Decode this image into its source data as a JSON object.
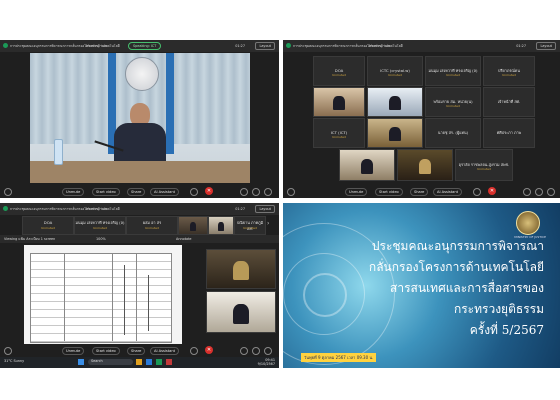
{
  "panel_tl": {
    "title": "การประชุมคณะอนุกรรมการพิจารณาการกลั่นกรองโครงการด้านเทคโนโลยี",
    "meeting_info": "Meeting info",
    "speaking": "Speaking: ICT",
    "time": "01:27",
    "layout": "Layout",
    "controls": {
      "unmute": "Unmute",
      "start_video": "Start video",
      "share": "Share",
      "ai_assistant": "AI Assistant"
    }
  },
  "panel_tr": {
    "title": "การประชุมคณะอนุกรรมการพิจารณาการกลั่นกรองโครงการด้านเทคโนโลยี",
    "meeting_info": "Meeting info",
    "time": "01:27",
    "layout": "Layout",
    "tiles": [
      {
        "name": "DOA",
        "sub": "Unmuted"
      },
      {
        "name": "ICTC (crystal.w)",
        "sub": "Unmuted"
      },
      {
        "name": "มนมุม เสงหวาที ทรงเจริญ (ล)",
        "sub": "Unmuted"
      },
      {
        "name": "ปรียาภรณ์ดน",
        "sub": "Unmuted"
      },
      {
        "name": "พร้อมราย สม. หน่วย(น)",
        "sub": "Unmuted"
      },
      {
        "name": "เจ้าหน้าที่ สศ.",
        "sub": ""
      },
      {
        "name": "ICT (ICT)",
        "sub": "Unmuted"
      },
      {
        "name": "นายชุ สร. (ผู้แทน)",
        "sub": ""
      },
      {
        "name": "ศศิประภา ภาพ",
        "sub": ""
      },
      {
        "name": "อุราลัย ราชพลจน-สูงรวม สพช.",
        "sub": "Unmuted"
      }
    ],
    "controls": {
      "unmute": "Unmute",
      "start_video": "Start video",
      "share": "Share",
      "ai_assistant": "AI Assistant"
    }
  },
  "panel_bl": {
    "title": "การประชุมคณะอนุกรรมการพิจารณาการกลั่นกรองโครงการด้านเทคโนโลยี",
    "meeting_info": "Meeting info",
    "time": "01:27",
    "layout": "Layout",
    "tiles": [
      {
        "name": "DOA",
        "sub": "Unmuted"
      },
      {
        "name": "มนมุม เสงหวาที ทรงเจริญ (ล)",
        "sub": "Unmuted"
      },
      {
        "name": "ผสม อา สร",
        "sub": "Unmuted"
      },
      {
        "name": "ปณิธาน ภาคภูมิ สศ.",
        "sub": "Unmuted"
      }
    ],
    "share_title": "Viewing แฟ้ม Aระเบียบ 1 screen",
    "zoom": "100%",
    "annotate": "Annotate",
    "controls": {
      "unmute": "Unmute",
      "start_video": "Start video",
      "share": "Share",
      "ai_assistant": "AI Assistant"
    },
    "taskbar": {
      "temp": "31°C",
      "weather": "Sunny",
      "search": "Search",
      "time": "09:41",
      "date": "9/10/2567"
    }
  },
  "slide": {
    "line1": "ประชุมคณะอนุกรรมการพิจารณา",
    "line2": "กลั่นกรองโครงการด้านเทคโนโลยี",
    "line3": "สารสนเทศและการสื่อสารของ",
    "line4": "กระทรวงยุติธรรม",
    "line5": "ครั้งที่ 5/2567",
    "date": "วันพุธที่ 9 ตุลาคม 2567 เวลา 09.30 น.",
    "seal_text": "MINISTRY OF JUSTICE"
  }
}
